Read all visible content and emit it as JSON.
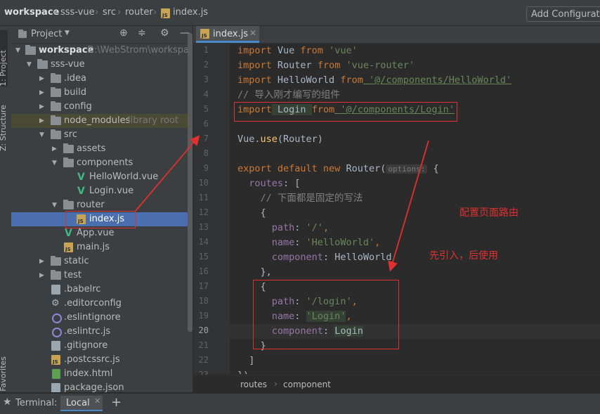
{
  "breadcrumb": {
    "items": [
      "workspace",
      "sss-vue",
      "src",
      "router",
      "index.js"
    ],
    "add_configuration": "Add Configuratio"
  },
  "left_strip": {
    "project_tab": "1: Project",
    "structure_tab": "Z: Structure",
    "favorites_tab": "2: Favorites"
  },
  "project_panel": {
    "title": "Project",
    "tree": [
      {
        "name": "workspace",
        "hint": "D:\\WebStrom\\workspac"
      },
      {
        "name": "sss-vue"
      },
      {
        "name": ".idea"
      },
      {
        "name": "build"
      },
      {
        "name": "config"
      },
      {
        "name": "node_modules",
        "hint": "library root"
      },
      {
        "name": "src"
      },
      {
        "name": "assets"
      },
      {
        "name": "components"
      },
      {
        "name": "HelloWorld.vue"
      },
      {
        "name": "Login.vue"
      },
      {
        "name": "router"
      },
      {
        "name": "index.js"
      },
      {
        "name": "App.vue"
      },
      {
        "name": "main.js"
      },
      {
        "name": "static"
      },
      {
        "name": "test"
      },
      {
        "name": ".babelrc"
      },
      {
        "name": ".editorconfig"
      },
      {
        "name": ".eslintignore"
      },
      {
        "name": ".eslintrc.js"
      },
      {
        "name": ".gitignore"
      },
      {
        "name": ".postcssrc.js"
      },
      {
        "name": "index.html"
      },
      {
        "name": "package.json"
      }
    ]
  },
  "editor": {
    "tab_label": "index.js",
    "line_numbers": [
      "1",
      "2",
      "3",
      "4",
      "5",
      "6",
      "7",
      "8",
      "9",
      "10",
      "11",
      "12",
      "13",
      "14",
      "15",
      "16",
      "17",
      "18",
      "19",
      "20",
      "21",
      "22",
      "23"
    ],
    "current_line": "20",
    "lines": {
      "l1": {
        "kw1": "import",
        "id": " Vue ",
        "kw2": "from",
        "str": " 'vue'"
      },
      "l2": {
        "kw1": "import",
        "id": " Router ",
        "kw2": "from",
        "str": " 'vue-router'"
      },
      "l3": {
        "kw1": "import",
        "id": " HelloWorld ",
        "kw2": "from",
        "str": " '@/components/HelloWorld'"
      },
      "l4": {
        "cmt": "// 导入刚才编写的组件"
      },
      "l5": {
        "kw1": "import",
        "id": " Login ",
        "kw2": "from",
        "str": " '@/components/Login'"
      },
      "l7": {
        "obj": "Vue.",
        "fn": "use",
        "rest": "(Router)"
      },
      "l9": {
        "kw": "export default new ",
        "cls": "Router(",
        "hint": "options:",
        "rest": " {"
      },
      "l10": {
        "prop": "  routes",
        "rest": ": ["
      },
      "l11": {
        "cmt": "    // 下面都是固定的写法"
      },
      "l12": {
        "text": "    {"
      },
      "l13": {
        "prop": "      path",
        "sep": ": ",
        "str": "'/'",
        "end": ","
      },
      "l14": {
        "prop": "      name",
        "sep": ": ",
        "str": "'HelloWorld'",
        "end": ","
      },
      "l15": {
        "prop": "      component",
        "sep": ": ",
        "val": "HelloWorld"
      },
      "l16": {
        "text": "    },"
      },
      "l17": {
        "text": "    {"
      },
      "l18": {
        "prop": "      path",
        "sep": ": ",
        "str": "'/login'",
        "end": ","
      },
      "l19": {
        "prop": "      name",
        "sep": ": ",
        "str": "'Login'",
        "end": ","
      },
      "l20": {
        "prop": "      component",
        "sep": ": ",
        "val": "Login"
      },
      "l21": {
        "text": "    }"
      },
      "l22": {
        "text": "  ]"
      },
      "l23": {
        "text": "})"
      }
    },
    "crumbs": [
      "routes",
      "component"
    ]
  },
  "annotations": {
    "note1": "配置页面路由",
    "note2": "先引入，后使用"
  },
  "bottom_bar": {
    "terminal_label": "Terminal:",
    "tab_local": "Local",
    "add": "+"
  },
  "colors": {
    "annotation_red": "#e03030",
    "selection_blue": "#4b6eaf",
    "library_root_bg": "#4b4a35"
  }
}
